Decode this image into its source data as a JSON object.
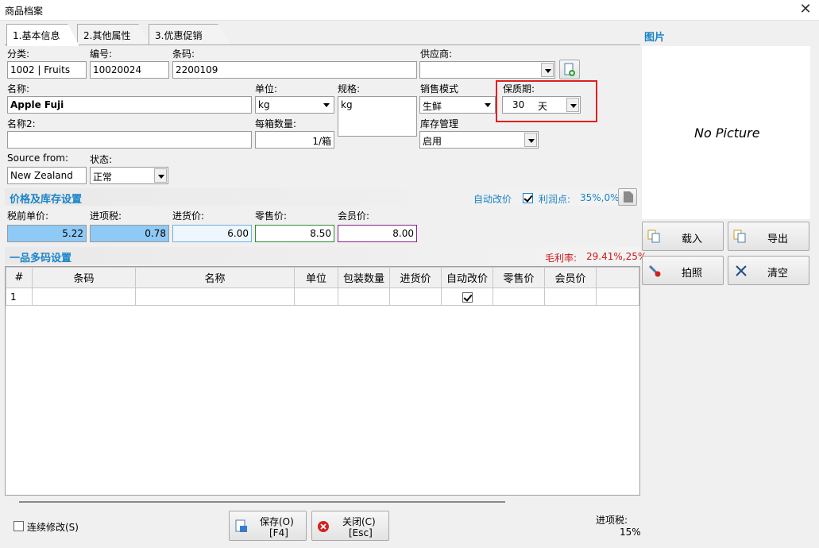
{
  "window": {
    "title": "商品档案",
    "close": "✕"
  },
  "tabs": [
    "1.基本信息",
    "2.其他属性",
    "3.优惠促销"
  ],
  "basic": {
    "category_label": "分类:",
    "category_value": "1002 | Fruits",
    "code_label": "编号:",
    "code_value": "10020024",
    "barcode_label": "条码:",
    "barcode_value": "2200109",
    "supplier_label": "供应商:",
    "supplier_value": "",
    "name_label": "名称:",
    "name_value": "Apple Fuji",
    "unit_label": "单位:",
    "unit_value": "kg",
    "spec_label": "规格:",
    "spec_value": "kg",
    "sale_mode_label": "销售模式",
    "sale_mode_value": "生鲜",
    "shelf_life_label": "保质期:",
    "shelf_life_value": "30",
    "shelf_life_unit": "天",
    "name2_label": "名称2:",
    "name2_value": "",
    "per_box_label": "每箱数量:",
    "per_box_value": "1/箱",
    "stock_mgmt_label": "库存管理",
    "stock_mgmt_value": "启用",
    "source_label": "Source from:",
    "source_value": "New Zealand",
    "status_label": "状态:",
    "status_value": "正常"
  },
  "price_section": {
    "title": "价格及库存设置",
    "auto_price_label": "自动改价",
    "auto_price_checked": true,
    "profit_label": "利润点:",
    "profit_value": "35%,0%",
    "pretax_label": "税前单价:",
    "pretax_value": "5.22",
    "input_tax_label": "进项税:",
    "input_tax_value": "0.78",
    "purchase_label": "进货价:",
    "purchase_value": "6.00",
    "retail_label": "零售价:",
    "retail_value": "8.50",
    "member_label": "会员价:",
    "member_value": "8.00"
  },
  "multi_code": {
    "title": "一品多码设置",
    "gross_margin_label": "毛利率:",
    "gross_margin_value": "29.41%,25%",
    "columns": [
      "#",
      "条码",
      "名称",
      "单位",
      "包装数量",
      "进货价",
      "自动改价",
      "零售价",
      "会员价"
    ],
    "rows": [
      {
        "num": "1",
        "barcode": "",
        "name": "",
        "unit": "",
        "pack": "",
        "purchase": "",
        "auto": true,
        "retail": "",
        "member": ""
      }
    ]
  },
  "picture": {
    "title": "图片",
    "placeholder": "No Picture",
    "load_label": "载入",
    "export_label": "导出",
    "photo_label": "拍照",
    "clear_label": "清空"
  },
  "footer": {
    "continuous_label": "连续修改(S)",
    "save_label": "保存(O)",
    "save_key": "[F4]",
    "close_label": "关闭(C)",
    "close_key": "[Esc]",
    "input_tax_label": "进项税:",
    "input_tax_value": "15%"
  },
  "colors": {
    "accent_blue": "#1b84c8",
    "highlight_red": "#e02020",
    "pretax_bg": "#8fc9f5",
    "retail_border": "#2e8b2e",
    "member_border": "#8a1f8a"
  }
}
